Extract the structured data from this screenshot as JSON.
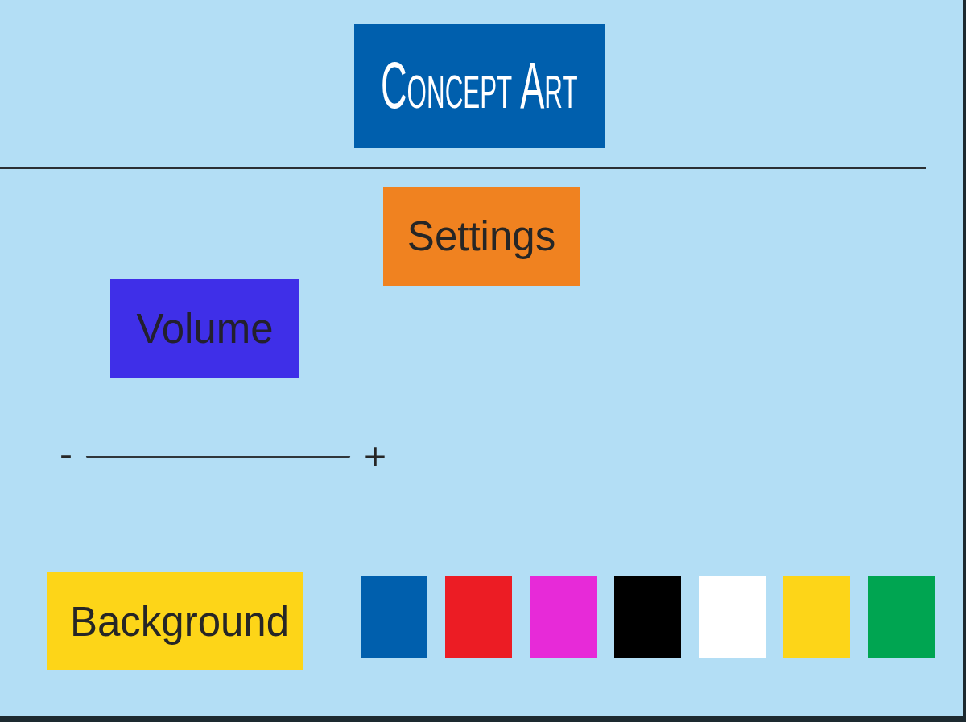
{
  "title": "Concept Art",
  "settings": {
    "heading": "Settings",
    "volume": {
      "label": "Volume",
      "decrease": "-",
      "increase": "+"
    },
    "background": {
      "label": "Background",
      "swatches": [
        {
          "color": "#005fad"
        },
        {
          "color": "#ec1c24"
        },
        {
          "color": "#e72ad8"
        },
        {
          "color": "#000000"
        },
        {
          "color": "#ffffff"
        },
        {
          "color": "#fdd518"
        },
        {
          "color": "#00a551"
        }
      ]
    }
  }
}
